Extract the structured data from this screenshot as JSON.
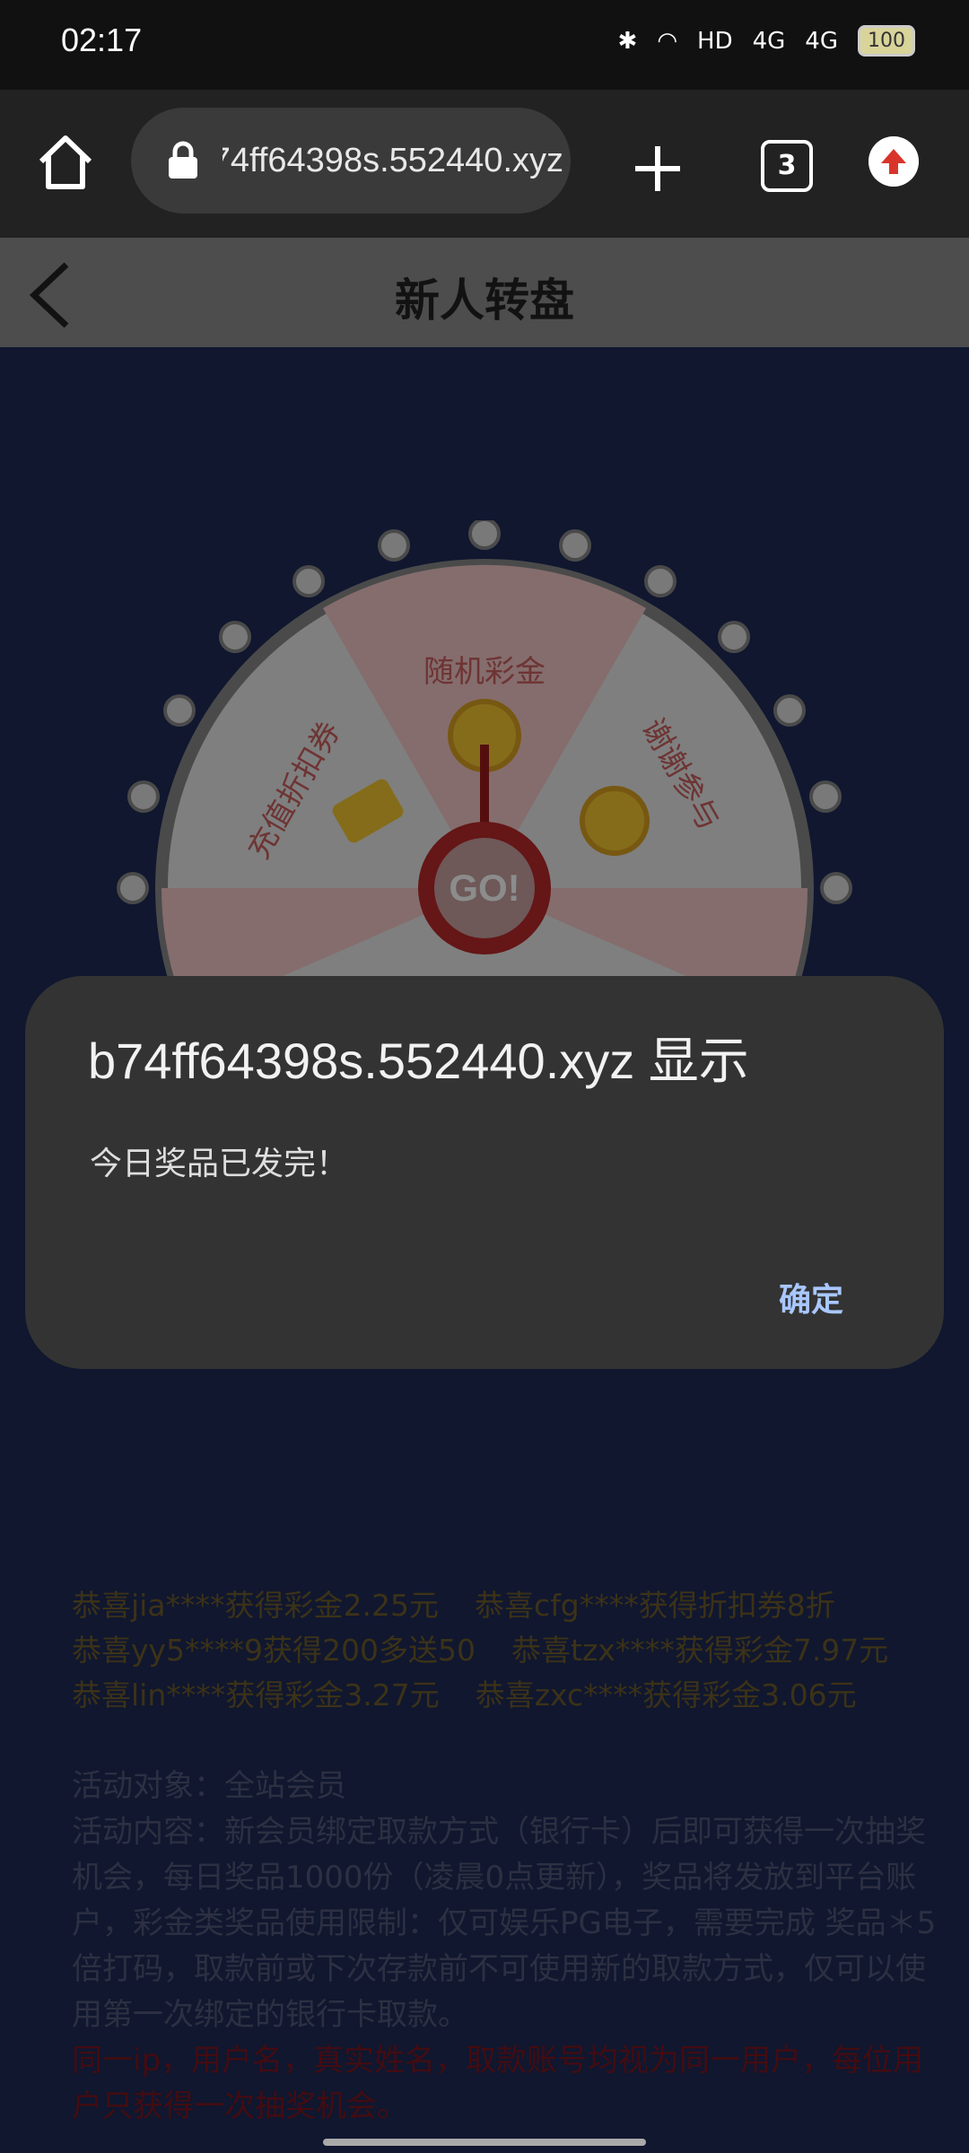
{
  "status_bar": {
    "time": "02:17",
    "network_labels": [
      "HD",
      "4G",
      "4G"
    ],
    "battery": "100"
  },
  "browser": {
    "url_visible": "b74ff64398s.552440.xyz",
    "tab_count": "3"
  },
  "page": {
    "title": "新人转盘",
    "wheel": {
      "segments": [
        "随机彩金",
        "谢谢参与",
        "充值折扣券"
      ],
      "go_label": "GO!"
    }
  },
  "winners": [
    [
      "恭喜jia****获得彩金2.25元",
      "恭喜cfg****获得折扣券8折"
    ],
    [
      "恭喜yy5****9获得200多送50",
      "恭喜tzx****获得彩金7.97元"
    ],
    [
      "恭喜lin****获得彩金3.27元",
      "恭喜zxc****获得彩金3.06元"
    ]
  ],
  "rules": {
    "target": "活动对象：全站会员",
    "content": "活动内容：新会员绑定取款方式（银行卡）后即可获得一次抽奖机会，每日奖品1000份（凌晨0点更新），奖品将发放到平台账户，彩金类奖品使用限制：仅可娱乐PG电子，需要完成 奖品＊5倍打码，取款前或下次存款前不可使用新的取款方式，仅可以使用第一次绑定的银行卡取款。",
    "warning": "同一ip，用户名，真实姓名，取款账号均视为同一用户，每位用户只获得一次抽奖机会。"
  },
  "dialog": {
    "title": "b74ff64398s.552440.xyz 显示",
    "message": "今日奖品已发完！",
    "ok_label": "确定"
  },
  "colors": {
    "page_bg": "#1e2a56",
    "dialog_bg": "#333333",
    "dialog_button": "#a9c7ff",
    "warning_text": "#7a1620"
  }
}
